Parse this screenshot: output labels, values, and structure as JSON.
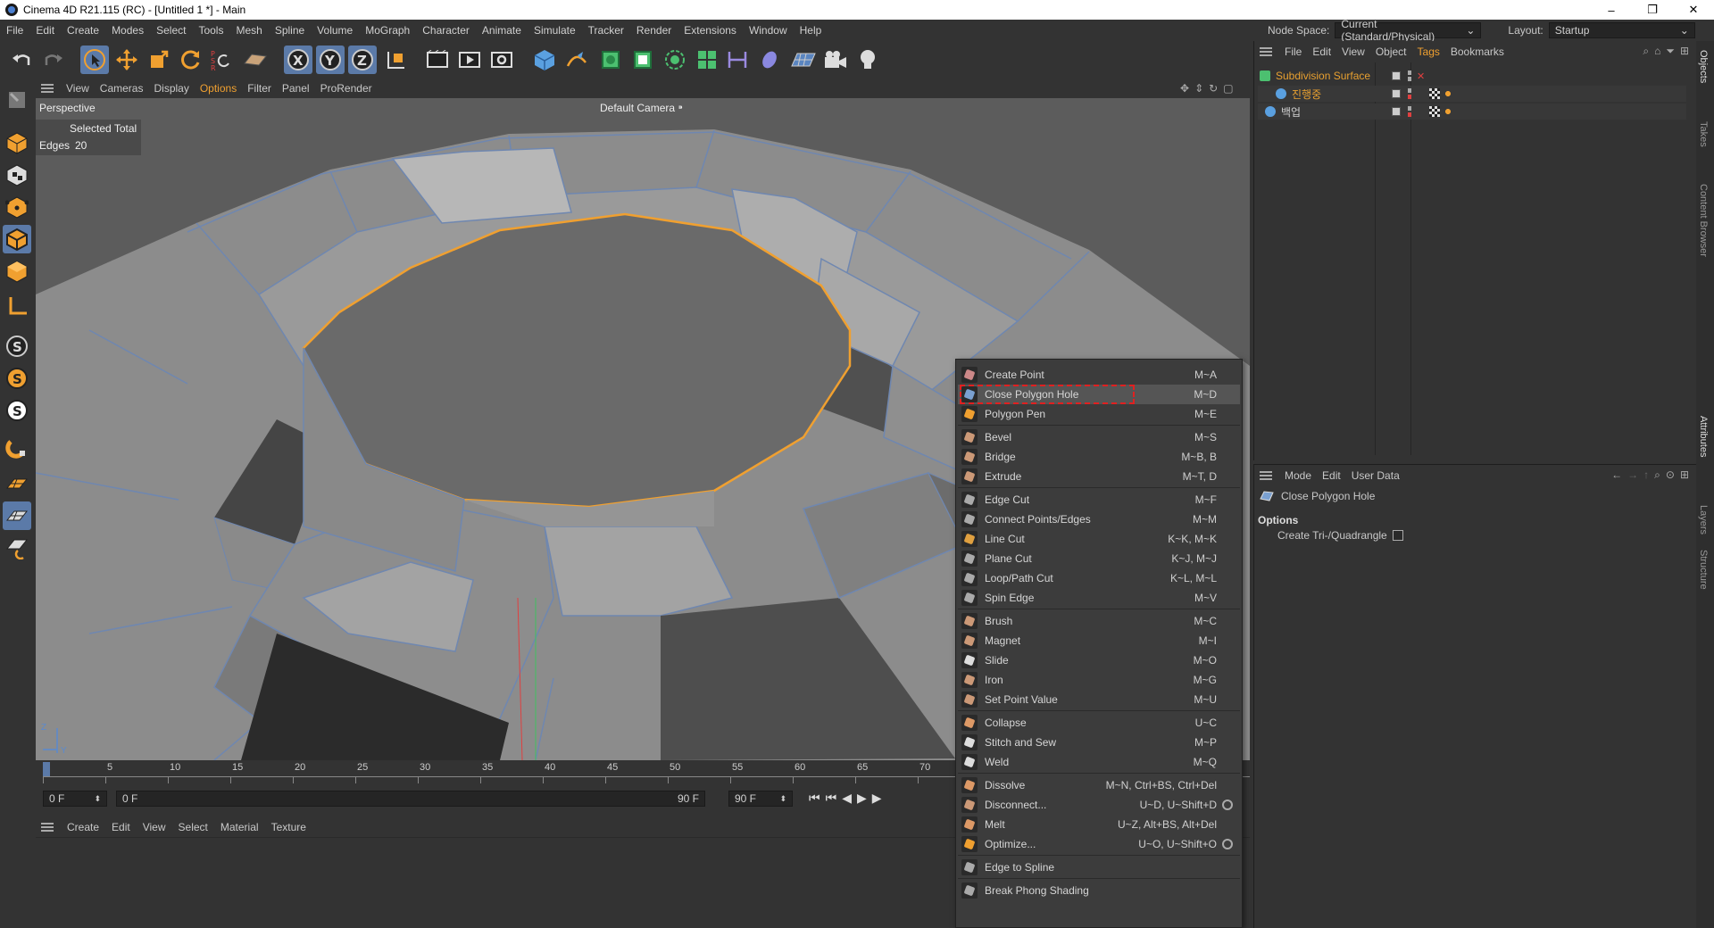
{
  "window": {
    "title": "Cinema 4D R21.115 (RC) - [Untitled 1 *] - Main",
    "minimize": "–",
    "restore": "❐",
    "close": "✕"
  },
  "menubar": [
    "File",
    "Edit",
    "Create",
    "Modes",
    "Select",
    "Tools",
    "Mesh",
    "Spline",
    "Volume",
    "MoGraph",
    "Character",
    "Animate",
    "Simulate",
    "Tracker",
    "Render",
    "Extensions",
    "Window",
    "Help"
  ],
  "nodespace": {
    "label": "Node Space:",
    "value": "Current (Standard/Physical)",
    "layout_label": "Layout:",
    "layout_value": "Startup"
  },
  "viewport_menu": [
    "View",
    "Cameras",
    "Display",
    "Options",
    "Filter",
    "Panel",
    "ProRender"
  ],
  "viewport": {
    "view_name": "Perspective",
    "camera": "Default Camera",
    "selected_header": "Selected Total",
    "edges_label": "Edges",
    "edges_value": "20",
    "axis_z": "Z",
    "axis_y": "Y"
  },
  "timeline": {
    "ticks": [
      "0",
      "5",
      "10",
      "15",
      "20",
      "25",
      "30",
      "35",
      "40",
      "45",
      "50",
      "55",
      "60",
      "65",
      "70"
    ]
  },
  "transport": {
    "start": "0 F",
    "current": "0 F",
    "end": "90 F",
    "end2": "90 F"
  },
  "material_menu": [
    "Create",
    "Edit",
    "View",
    "Select",
    "Material",
    "Texture"
  ],
  "object_menu": [
    "File",
    "Edit",
    "View",
    "Object",
    "Tags",
    "Bookmarks"
  ],
  "objects": [
    {
      "name": "Subdivision Surface",
      "color": "#e8a030"
    },
    {
      "name": "진행중",
      "color": "#e8a030"
    },
    {
      "name": "백업",
      "color": "#cfcfcf"
    }
  ],
  "attr_menu": [
    "Mode",
    "Edit",
    "User Data"
  ],
  "attributes": {
    "tool_name": "Close Polygon Hole",
    "section": "Options",
    "option_label": "Create Tri-/Quadrangle"
  },
  "side_tabs": [
    "Objects",
    "Takes",
    "Content Browser",
    "Attributes",
    "Layers",
    "Structure"
  ],
  "context_menu": [
    {
      "label": "Create Point",
      "shortcut": "M~A"
    },
    {
      "label": "Close Polygon Hole",
      "shortcut": "M~D",
      "highlight": true
    },
    {
      "label": "Polygon Pen",
      "shortcut": "M~E"
    },
    {
      "label": "Bevel",
      "shortcut": "M~S"
    },
    {
      "label": "Bridge",
      "shortcut": "M~B, B"
    },
    {
      "label": "Extrude",
      "shortcut": "M~T, D"
    },
    {
      "label": "Edge Cut",
      "shortcut": "M~F"
    },
    {
      "label": "Connect Points/Edges",
      "shortcut": "M~M"
    },
    {
      "label": "Line Cut",
      "shortcut": "K~K, M~K"
    },
    {
      "label": "Plane Cut",
      "shortcut": "K~J, M~J"
    },
    {
      "label": "Loop/Path Cut",
      "shortcut": "K~L, M~L"
    },
    {
      "label": "Spin Edge",
      "shortcut": "M~V"
    },
    {
      "label": "Brush",
      "shortcut": "M~C"
    },
    {
      "label": "Magnet",
      "shortcut": "M~I"
    },
    {
      "label": "Slide",
      "shortcut": "M~O"
    },
    {
      "label": "Iron",
      "shortcut": "M~G"
    },
    {
      "label": "Set Point Value",
      "shortcut": "M~U"
    },
    {
      "label": "Collapse",
      "shortcut": "U~C"
    },
    {
      "label": "Stitch and Sew",
      "shortcut": "M~P"
    },
    {
      "label": "Weld",
      "shortcut": "M~Q"
    },
    {
      "label": "Dissolve",
      "shortcut": "M~N, Ctrl+BS, Ctrl+Del"
    },
    {
      "label": "Disconnect...",
      "shortcut": "U~D, U~Shift+D"
    },
    {
      "label": "Melt",
      "shortcut": "U~Z, Alt+BS, Alt+Del"
    },
    {
      "label": "Optimize...",
      "shortcut": "U~O, U~Shift+O"
    },
    {
      "label": "Edge to Spline",
      "shortcut": ""
    },
    {
      "label": "Break Phong Shading",
      "shortcut": ""
    }
  ],
  "colors": {
    "accent": "#5b7aa8",
    "selection": "#f0a030",
    "highlight_box": "#e02020",
    "mesh": "#8a8a8a"
  }
}
